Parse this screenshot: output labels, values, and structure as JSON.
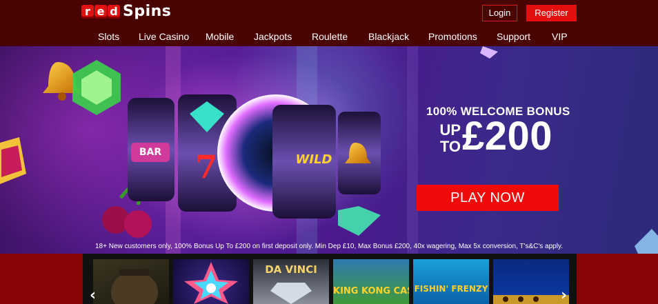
{
  "brand": {
    "logo_letters": [
      "r",
      "e",
      "d"
    ],
    "logo_word": "Spins",
    "accent": "#e30f0f"
  },
  "auth": {
    "login_label": "Login",
    "register_label": "Register"
  },
  "nav": [
    "Slots",
    "Live Casino",
    "Mobile",
    "Jackpots",
    "Roulette",
    "Blackjack",
    "Promotions",
    "Support",
    "VIP"
  ],
  "hero": {
    "headline": "100% WELCOME BONUS",
    "up_to_line1": "UP",
    "up_to_line2": "TO",
    "amount": "£200",
    "cta_label": "PLAY NOW",
    "terms": "18+ New customers only, 100% Bonus Up To £200 on first deposit only. Min Dep £10, Max Bonus £200, 40x wagering, Max 5x conversion, T's&C's apply.",
    "reel_symbols": [
      "BAR",
      "7",
      "WILD"
    ]
  },
  "games": {
    "tiles": [
      {
        "name": "adventurer-tile",
        "title": ""
      },
      {
        "name": "starburst-tile",
        "title": ""
      },
      {
        "name": "da-vinci-tile",
        "title": "DA VINCI"
      },
      {
        "name": "king-kong-cash-tile",
        "title": "KING KONG CASH"
      },
      {
        "name": "fishin-frenzy-tile",
        "title": "FISHIN' FRENZY"
      },
      {
        "name": "egyptian-tile",
        "title": ""
      }
    ],
    "prev_icon": "chevron-left-icon",
    "next_icon": "chevron-right-icon"
  }
}
